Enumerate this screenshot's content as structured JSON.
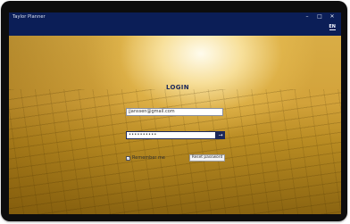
{
  "window": {
    "title": "Taylor Planner",
    "minimize_glyph": "–",
    "maximize_glyph": "□",
    "close_glyph": "✕"
  },
  "language": {
    "current": "EN"
  },
  "login": {
    "heading": "LOGIN",
    "email_value": "jjanssen@gmail.com",
    "password_value": "••••••••••",
    "submit_glyph": "→",
    "remember_checked_glyph": "✓",
    "remember_label": "Remember me",
    "reset_label": "Reset password"
  },
  "colors": {
    "titlebar": "#0b1e57",
    "accent": "#1b2759",
    "background_gold": "#d2a23a"
  },
  "icons": [
    "minimize-icon",
    "maximize-icon",
    "close-icon",
    "arrow-right-icon",
    "checkmark-icon"
  ]
}
